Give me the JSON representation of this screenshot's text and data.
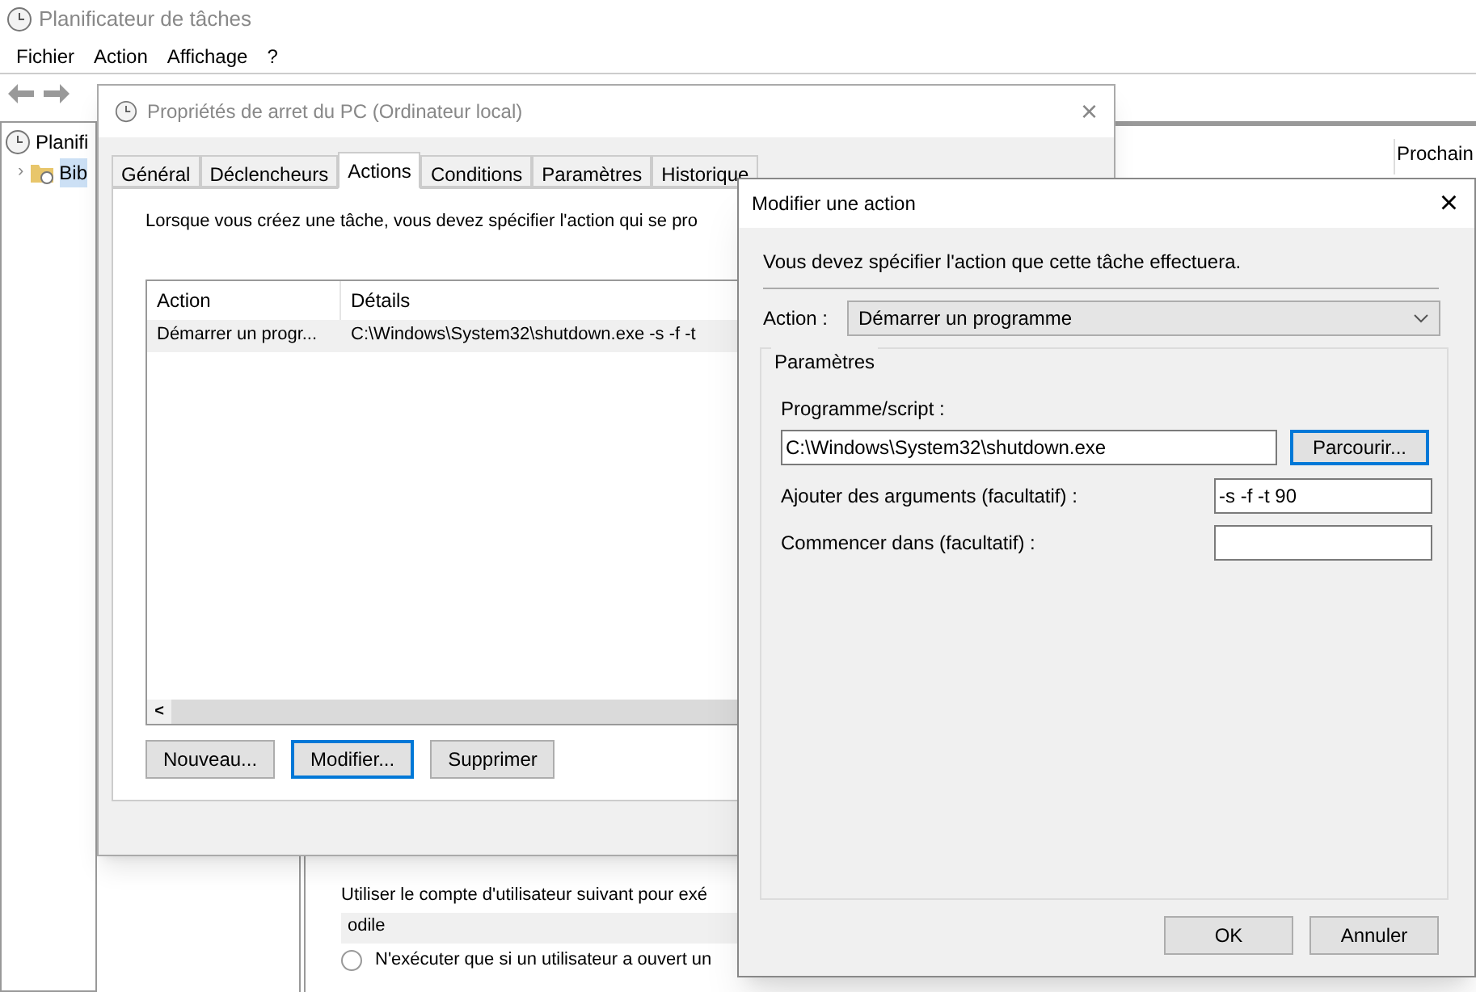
{
  "main_window": {
    "title": "Planificateur de tâches",
    "menu": [
      "Fichier",
      "Action",
      "Affichage",
      "?"
    ],
    "tree": [
      {
        "label": "Planifi",
        "children": [
          {
            "label": "Bib",
            "toggle": "›",
            "selected": true
          }
        ]
      }
    ],
    "right_panel": {
      "column_header": "Prochain"
    },
    "lower_pane": {
      "account_text": "Utiliser le compte d'utilisateur suivant pour exé",
      "account": "odile",
      "radio_label": "N'exécuter que si un utilisateur a ouvert un",
      "radio_selected": false
    }
  },
  "properties_dialog": {
    "title": "Propriétés de arret du PC (Ordinateur local)",
    "tabs": [
      {
        "label": "Général",
        "selected": false
      },
      {
        "label": "Déclencheurs",
        "selected": false
      },
      {
        "label": "Actions",
        "selected": true
      },
      {
        "label": "Conditions",
        "selected": false
      },
      {
        "label": "Paramètres",
        "selected": false
      },
      {
        "label": "Historique",
        "selected": false
      }
    ],
    "description": "Lorsque vous créez une tâche, vous devez spécifier l'action qui se pro",
    "table": {
      "columns": [
        "Action",
        "Détails"
      ],
      "rows": [
        {
          "cells": [
            "Démarrer un progr...",
            "C:\\Windows\\System32\\shutdown.exe -s -f -t"
          ],
          "selected": true
        }
      ]
    },
    "scroll_arrow": "<",
    "buttons": [
      {
        "label": "Nouveau...",
        "focused": false
      },
      {
        "label": "Modifier...",
        "focused": true
      },
      {
        "label": "Supprimer",
        "focused": false
      }
    ]
  },
  "edit_dialog": {
    "title": "Modifier une action",
    "close": "×",
    "instruction": "Vous devez spécifier l'action que cette tâche effectuera.",
    "action_label": "Action :",
    "action_value": "Démarrer un programme",
    "group_title": "Paramètres",
    "program_label": "Programme/script :",
    "program_value": "C:\\Windows\\System32\\shutdown.exe",
    "browse_button": "Parcourir...",
    "args_label": "Ajouter des arguments (facultatif) :",
    "args_value": "-s -f -t 90",
    "start_label": "Commencer dans (facultatif) :",
    "buttons": [
      "OK",
      "Annuler"
    ]
  }
}
